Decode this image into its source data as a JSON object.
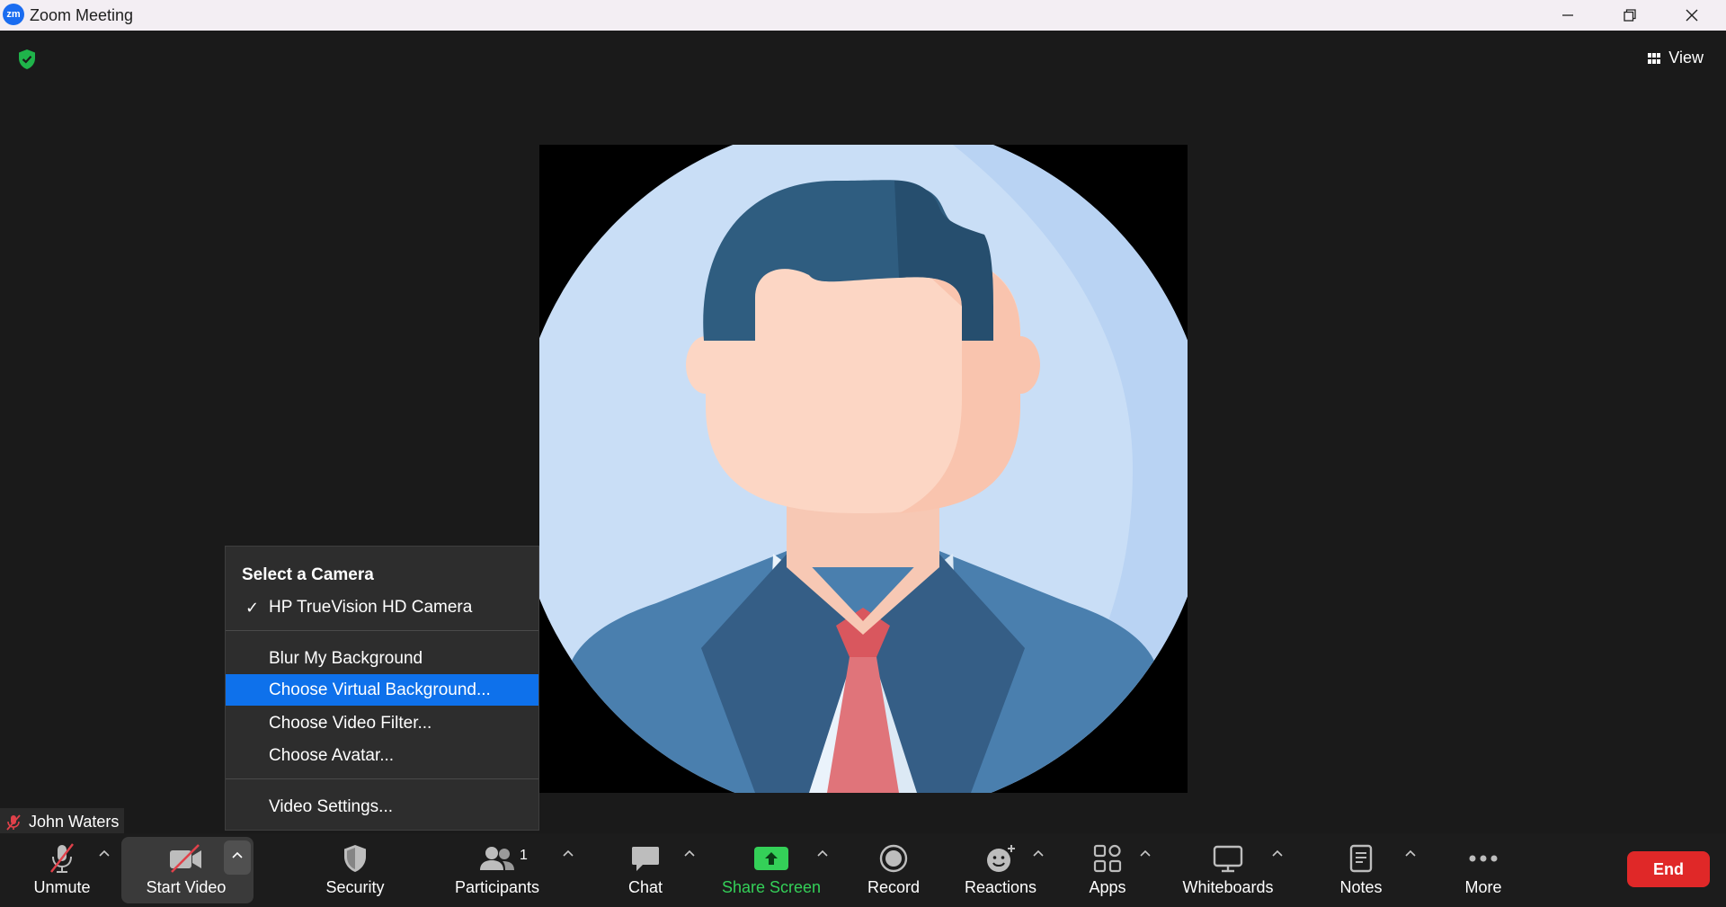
{
  "window": {
    "title": "Zoom Meeting",
    "logo_text": "zm"
  },
  "meeting": {
    "view_label": "View",
    "participant_name": "John Waters"
  },
  "camera_menu": {
    "header": "Select a Camera",
    "camera": "HP TrueVision HD Camera",
    "items": [
      {
        "label": "Blur My Background"
      },
      {
        "label": "Choose Virtual Background..."
      },
      {
        "label": "Choose Video Filter..."
      },
      {
        "label": "Choose Avatar..."
      }
    ],
    "settings": "Video Settings..."
  },
  "toolbar": {
    "unmute": "Unmute",
    "start_video": "Start Video",
    "security": "Security",
    "participants": "Participants",
    "participants_count": "1",
    "chat": "Chat",
    "share_screen": "Share Screen",
    "record": "Record",
    "reactions": "Reactions",
    "apps": "Apps",
    "whiteboards": "Whiteboards",
    "notes": "Notes",
    "more": "More",
    "end": "End"
  },
  "colors": {
    "accent": "#0e71eb",
    "share_green": "#34d058",
    "end_red": "#e02828",
    "shield_green": "#1fb34a"
  }
}
